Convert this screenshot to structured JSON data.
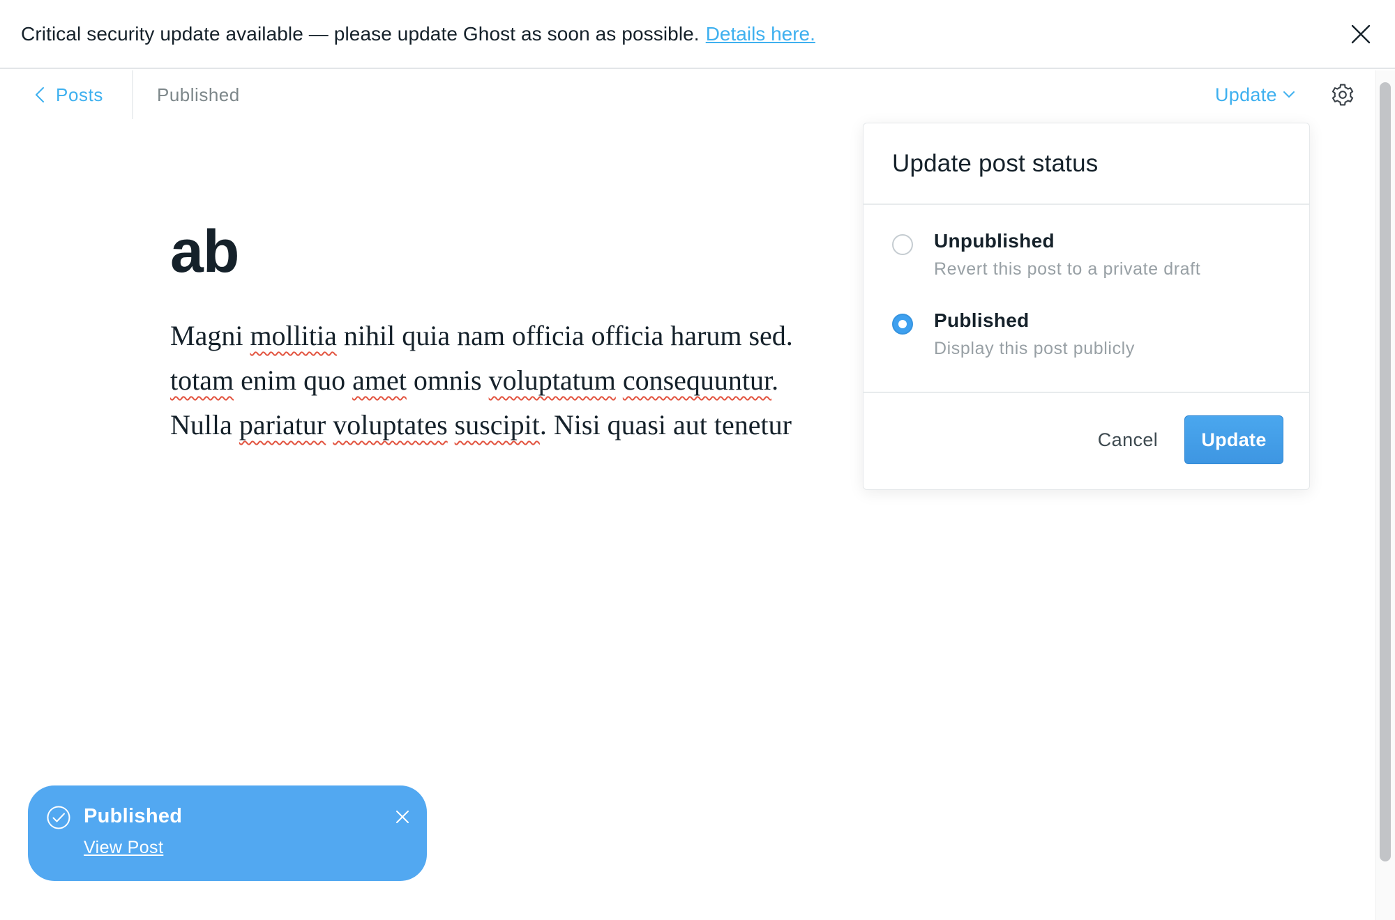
{
  "alert": {
    "message": "Critical security update available — please update Ghost as soon as possible.",
    "link_text": "Details here.",
    "close_icon": "close-icon"
  },
  "header": {
    "back_label": "Posts",
    "back_icon": "chevron-left-icon",
    "status": "Published",
    "update_label": "Update",
    "update_icon": "chevron-down-icon",
    "settings_icon": "gear-icon"
  },
  "post": {
    "title": "ab",
    "body_lines": [
      [
        "Magni ",
        "mollitia",
        " nihil quia nam officia officia harum sed."
      ],
      [
        "totam",
        " enim quo ",
        "amet",
        " omnis ",
        "voluptatum",
        " ",
        "consequuntur",
        "."
      ],
      [
        "Nulla ",
        "pariatur",
        " ",
        "voluptates",
        " ",
        "suscipit",
        ". Nisi quasi aut tenetur"
      ]
    ]
  },
  "popover": {
    "title": "Update post status",
    "options": [
      {
        "label": "Unpublished",
        "description": "Revert this post to a private draft",
        "selected": false
      },
      {
        "label": "Published",
        "description": "Display this post publicly",
        "selected": true
      }
    ],
    "cancel_label": "Cancel",
    "update_label": "Update"
  },
  "toast": {
    "title": "Published",
    "link_text": "View Post",
    "check_icon": "check-circle-icon",
    "close_icon": "close-icon"
  },
  "colors": {
    "accent": "#3eb0ef",
    "toast_bg": "#52a8f1",
    "spellcheck": "#e25440"
  }
}
